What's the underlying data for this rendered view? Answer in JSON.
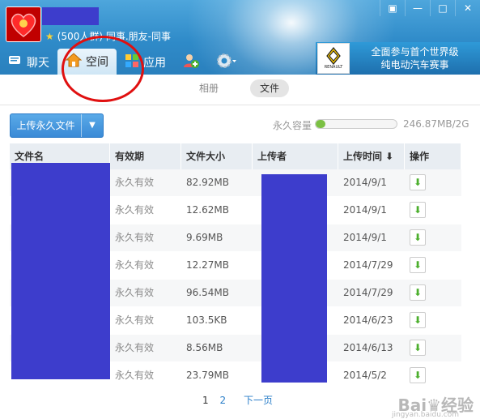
{
  "group": {
    "meta": "(500人群) 同事.朋友-同事"
  },
  "window_controls": [
    "▣",
    "—",
    "□",
    "✕"
  ],
  "nav": [
    {
      "label": "聊天",
      "icon": "chat-icon"
    },
    {
      "label": "空间",
      "icon": "home-icon",
      "active": true
    },
    {
      "label": "应用",
      "icon": "apps-icon"
    }
  ],
  "ad": {
    "logo_text": "RENAULT",
    "line1": "全面参与首个世界级",
    "line2": "纯电动汽车赛事"
  },
  "subtabs": {
    "album": "相册",
    "files": "文件"
  },
  "toolbar": {
    "upload_label": "上传永久文件",
    "quota_label": "永久容量",
    "quota_value": "246.87MB/2G",
    "quota_fraction": 0.12
  },
  "table": {
    "headers": [
      "文件名",
      "有效期",
      "文件大小",
      "上传者",
      "上传时间 ⬇",
      "操作"
    ],
    "rows": [
      {
        "validity": "永久有效",
        "size": "82.92MB",
        "date": "2014/9/1"
      },
      {
        "validity": "永久有效",
        "size": "12.62MB",
        "date": "2014/9/1"
      },
      {
        "validity": "永久有效",
        "size": "9.69MB",
        "date": "2014/9/1"
      },
      {
        "validity": "永久有效",
        "size": "12.27MB",
        "date": "2014/7/29"
      },
      {
        "validity": "永久有效",
        "size": "96.54MB",
        "date": "2014/7/29"
      },
      {
        "validity": "永久有效",
        "size": "103.5KB",
        "date": "2014/6/23"
      },
      {
        "validity": "永久有效",
        "size": "8.56MB",
        "date": "2014/6/13"
      },
      {
        "validity": "永久有效",
        "size": "23.79MB",
        "date": "2014/5/2"
      }
    ]
  },
  "pager": {
    "page1": "1",
    "page2": "2",
    "next": "下一页"
  },
  "watermark": {
    "main": "Bai♛经验",
    "sub": "jingyan.baidu.com"
  },
  "colors": {
    "accent": "#2f8bc9",
    "mask": "#3d3dcc",
    "highlight_circle": "#e01010",
    "download": "#4caf2d"
  }
}
